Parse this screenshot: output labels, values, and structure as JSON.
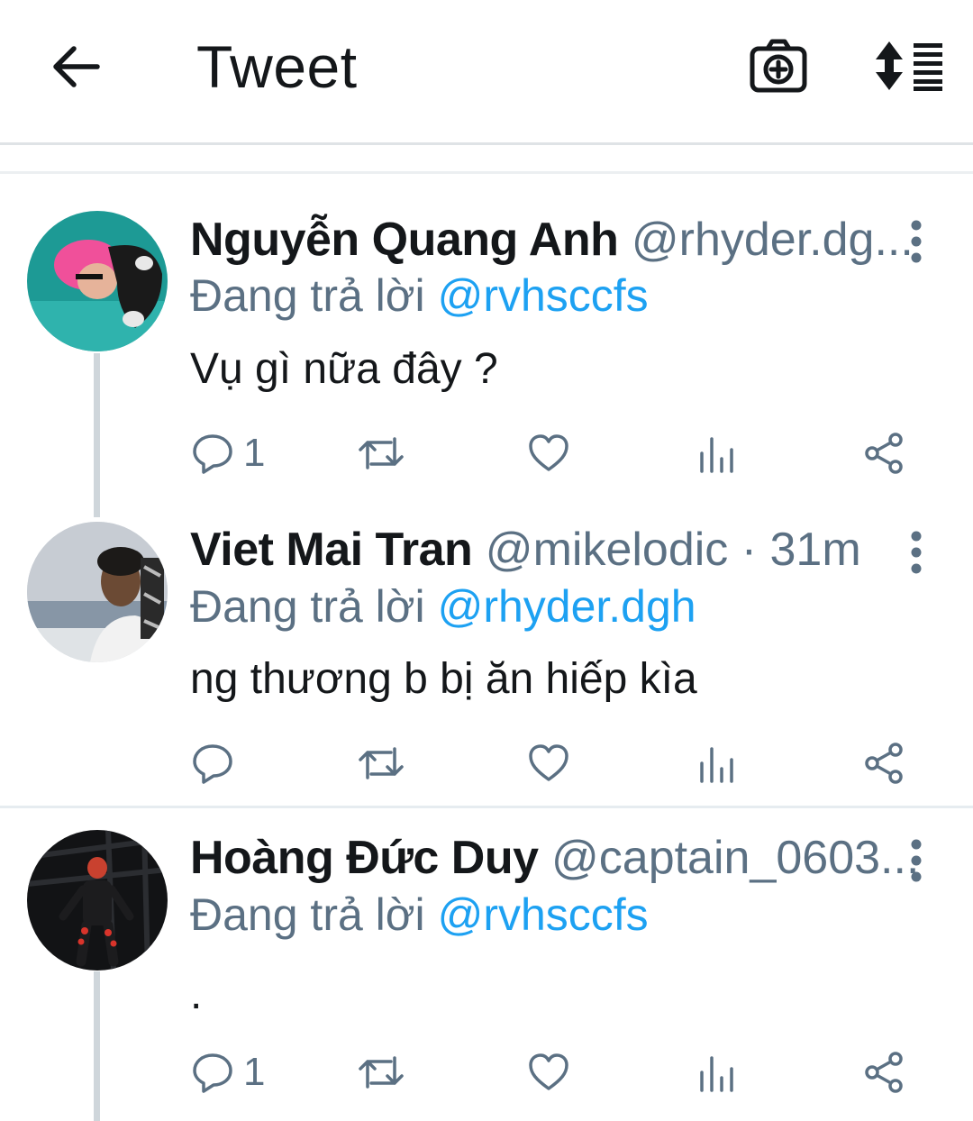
{
  "appbar": {
    "title": "Tweet",
    "back_icon": "arrow-left-icon",
    "camera_icon": "camera-plus-icon",
    "sort_icon": "sort-icon"
  },
  "tweets": [
    {
      "name": "Nguyễn Quang Anh",
      "handle": "@rhyder.dg...",
      "reply_prefix": "Đang trả lời ",
      "reply_to": "@rvhsccfs",
      "text": "Vụ gì nữa đây ?",
      "reply_count": "1"
    },
    {
      "name": "Viet Mai Tran",
      "handle": "@mikelodic · 31m",
      "reply_prefix": "Đang trả lời ",
      "reply_to": "@rhyder.dgh",
      "text": "ng thương b bị ăn hiếp kìa",
      "reply_count": ""
    },
    {
      "name": "Hoàng Đức Duy",
      "handle": "@captain_0603...",
      "reply_prefix": "Đang trả lời ",
      "reply_to": "@rvhsccfs",
      "text": ".",
      "reply_count": "1"
    }
  ],
  "colors": {
    "accent": "#1da1f2",
    "secondary_text": "#5b7083",
    "primary_text": "#14171a",
    "divider": "#e6ecf0"
  }
}
